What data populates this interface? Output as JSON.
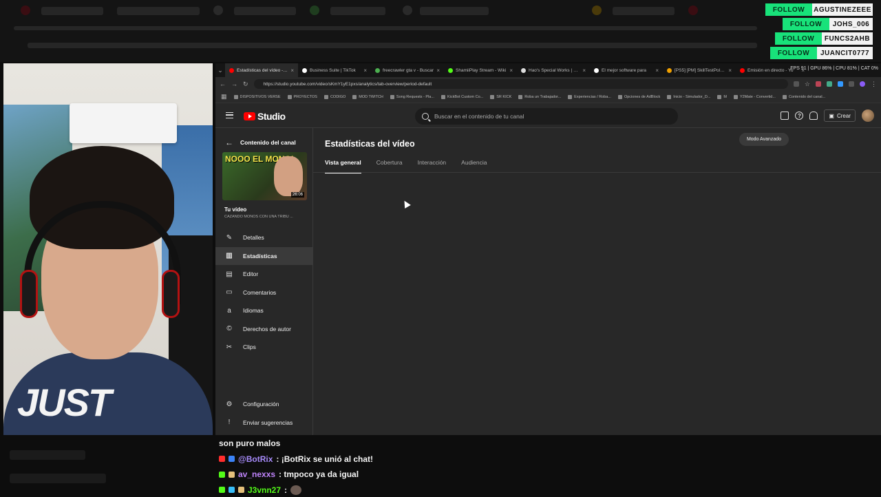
{
  "alerts": [
    {
      "button": "FOLLOW",
      "name": "AGUSTINEZEEE"
    },
    {
      "button": "FOLLOW",
      "name": "JOHS_006"
    },
    {
      "button": "FOLLOW",
      "name": "FUNCS2AHB"
    },
    {
      "button": "FOLLOW",
      "name": "JUANCIT0777"
    }
  ],
  "browser": {
    "tabs": [
      {
        "label": "Estadísticas del vídeo - Yo",
        "color": "#ff0000",
        "active": true
      },
      {
        "label": "Business Suite | TikTok",
        "color": "#ffffff",
        "active": false
      },
      {
        "label": "freecrawler gta v - Buscar",
        "color": "#4caf50",
        "active": false
      },
      {
        "label": "ShamiiPlay Stream - Wiki",
        "color": "#53fc18",
        "active": false
      },
      {
        "label": "Hao's Special Works | Gre",
        "color": "#dddddd",
        "active": false
      },
      {
        "label": "El mejor software para",
        "color": "#ffffff",
        "active": false
      },
      {
        "label": "[PS5] [PM] SkillTestPolym",
        "color": "#f0a000",
        "active": false
      },
      {
        "label": "Emisión en directo - Yo",
        "color": "#ff0000",
        "active": false
      }
    ],
    "sysinfo": "FPS 91 | GPU 86% | CPU 81% | CAT 0%",
    "url": "https://studio.youtube.com/video/sKmY1yE1pxs/analytics/tab-overview/period-default",
    "bookmarks": [
      "DISPOSITIVOS VERSE",
      "PROYECTOS",
      "CODIGO",
      "MOD TWITCH",
      "Song Requests - Pla...",
      "KickBot Custom Co...",
      "SR KICK",
      "Roba un Trabajador...",
      "Experiencias / Roba...",
      "Opciones de AdBlock",
      "Inicio - Simulador_D...",
      "M",
      "Y2Mate - Convertid...",
      "Contenido del canal..."
    ]
  },
  "studio": {
    "logo_text": "Studio",
    "search_placeholder": "Buscar en el contenido de tu canal",
    "create_label": "Crear",
    "back_label": "Contenido del canal",
    "thumb_text": "NOOO EL MONO!",
    "duration": "26:06",
    "your_video": "Tu vídeo",
    "video_title": "CAZANDO MONOS CON UNA TRIBU ...",
    "nav": [
      {
        "label": "Detalles",
        "icon": "✎",
        "active": false
      },
      {
        "label": "Estadísticas",
        "icon": "▥",
        "active": true
      },
      {
        "label": "Editor",
        "icon": "▤",
        "active": false
      },
      {
        "label": "Comentarios",
        "icon": "▭",
        "active": false
      },
      {
        "label": "Idiomas",
        "icon": "a",
        "active": false
      },
      {
        "label": "Derechos de autor",
        "icon": "©",
        "active": false
      },
      {
        "label": "Clips",
        "icon": "✂",
        "active": false
      }
    ],
    "bottom_nav": [
      {
        "label": "Configuración",
        "icon": "⚙"
      },
      {
        "label": "Enviar sugerencias",
        "icon": "!"
      }
    ],
    "page_title": "Estadísticas del vídeo",
    "advanced_mode": "Modo Avanzado",
    "tabs": [
      "Vista general",
      "Cobertura",
      "Interacción",
      "Audiencia"
    ]
  },
  "chat": [
    {
      "user": "",
      "user_color": "#ffffff",
      "text": "son puro malos",
      "badges": []
    },
    {
      "user": "@BotRix",
      "user_color": "#a78bfa",
      "text": ": ¡BotRix se unió al chat!",
      "badges": [
        "#ff2d2d",
        "#3b82f6"
      ]
    },
    {
      "user": "av_nexxs",
      "user_color": "#c084fc",
      "text": ": tmpoco ya da igual",
      "badges": [
        "#53fc18",
        "#e5c07b"
      ]
    },
    {
      "user": "J3vnn27",
      "user_color": "#53fc18",
      "text": ":",
      "badges": [
        "#53fc18",
        "#38bdf8",
        "#e5c07b"
      ]
    }
  ]
}
